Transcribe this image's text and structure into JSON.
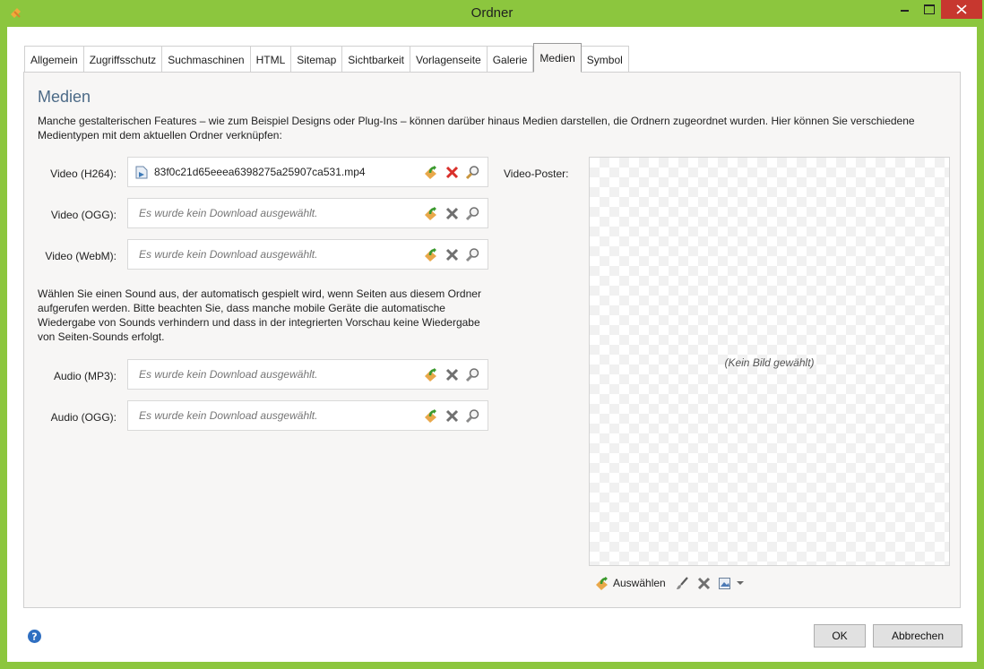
{
  "window": {
    "title": "Ordner",
    "app_icon": "zeta-producer-icon",
    "frame_color": "#8cc63e",
    "close_color": "#c7372f"
  },
  "tabs": [
    {
      "label": "Allgemein",
      "active": false
    },
    {
      "label": "Zugriffsschutz",
      "active": false
    },
    {
      "label": "Suchmaschinen",
      "active": false
    },
    {
      "label": "HTML",
      "active": false
    },
    {
      "label": "Sitemap",
      "active": false
    },
    {
      "label": "Sichtbarkeit",
      "active": false
    },
    {
      "label": "Vorlagenseite",
      "active": false
    },
    {
      "label": "Galerie",
      "active": false
    },
    {
      "label": "Medien",
      "active": true
    },
    {
      "label": "Symbol",
      "active": false
    }
  ],
  "panel": {
    "heading": "Medien",
    "intro": "Manche gestalterischen Features – wie zum Beispiel Designs oder Plug-Ins – können darüber hinaus Medien darstellen, die Ordnern zugeordnet wurden. Hier können Sie verschiedene Medientypen mit dem aktuellen Ordner verknüpfen:",
    "video_fields": [
      {
        "label": "Video (H264):",
        "value": "83f0c21d65eeea6398275a25907ca531.mp4",
        "has_file": true
      },
      {
        "label": "Video (OGG):",
        "value": "Es wurde kein Download ausgewählt.",
        "has_file": false
      },
      {
        "label": "Video (WebM):",
        "value": "Es wurde kein Download ausgewählt.",
        "has_file": false
      }
    ],
    "sound_text": "Wählen Sie einen Sound aus, der automatisch gespielt wird, wenn Seiten aus diesem Ordner aufgerufen werden. Bitte beachten Sie, dass manche mobile Geräte die automatische Wiedergabe von Sounds verhindern und dass in der integrierten Vorschau keine Wiedergabe von Seiten-Sounds erfolgt.",
    "audio_fields": [
      {
        "label": "Audio (MP3):",
        "value": "Es wurde kein Download ausgewählt.",
        "has_file": false
      },
      {
        "label": "Audio (OGG):",
        "value": "Es wurde kein Download ausgewählt.",
        "has_file": false
      }
    ],
    "poster": {
      "label": "Video-Poster:",
      "empty_text": "(Kein Bild gewählt)",
      "choose_label": "Auswählen"
    }
  },
  "footer": {
    "ok_label": "OK",
    "cancel_label": "Abbrechen"
  }
}
